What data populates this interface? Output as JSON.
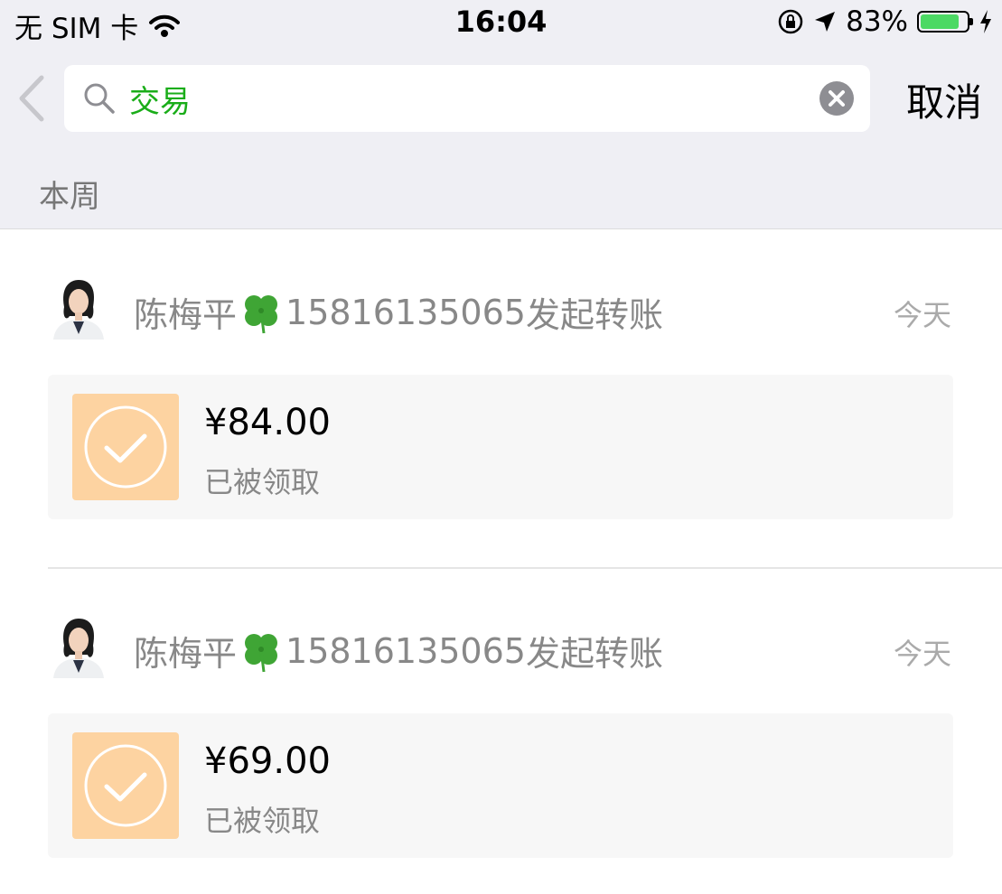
{
  "status_bar": {
    "carrier": "无 SIM 卡",
    "time": "16:04",
    "battery_percent": "83%",
    "battery_level": 0.83,
    "icons": [
      "wifi-icon",
      "orientation-lock-icon",
      "location-arrow-icon",
      "battery-icon",
      "charging-bolt-icon"
    ]
  },
  "search": {
    "query": "交易",
    "cancel_label": "取消"
  },
  "section": {
    "title": "本周"
  },
  "records": [
    {
      "sender_name": "陈梅平",
      "emoji": "four-leaf-clover",
      "sender_phone": "15816135065",
      "action": "发起转账",
      "date": "今天",
      "amount": "¥84.00",
      "status": "已被领取"
    },
    {
      "sender_name": "陈梅平",
      "emoji": "four-leaf-clover",
      "sender_phone": "15816135065",
      "action": "发起转账",
      "date": "今天",
      "amount": "¥69.00",
      "status": "已被领取"
    }
  ],
  "colors": {
    "accent_green": "#1aad19",
    "header_bg": "#efeff4",
    "transfer_icon_bg": "#fdd3a1",
    "battery_green": "#4cd964"
  }
}
